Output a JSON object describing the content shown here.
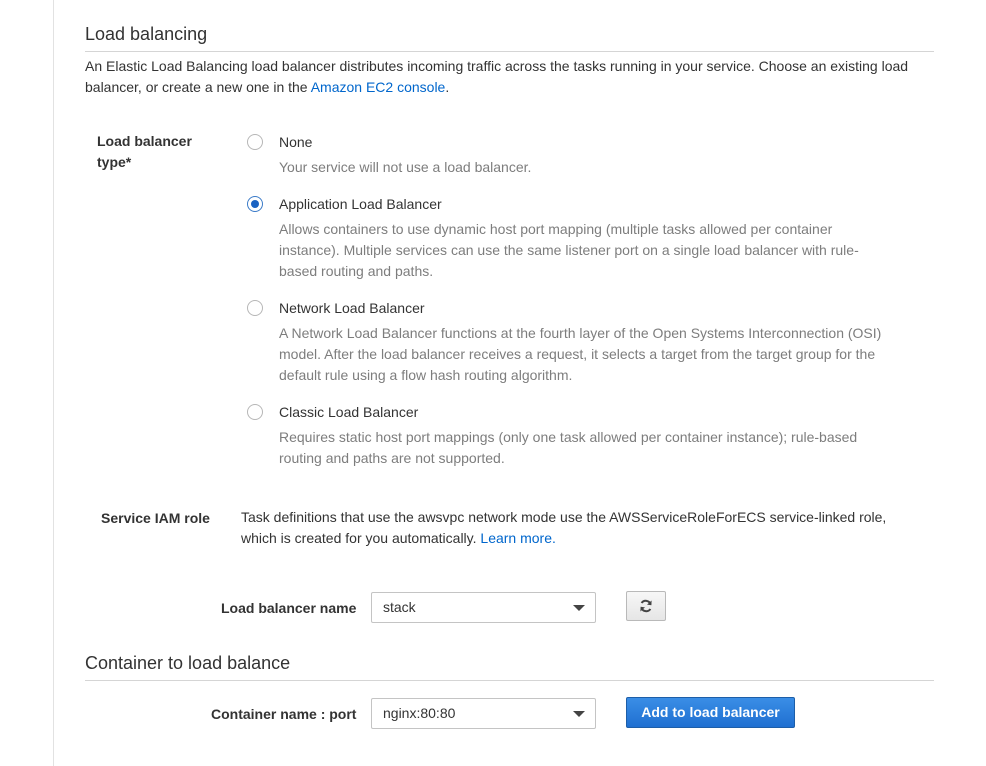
{
  "load_balancing": {
    "title": "Load balancing",
    "description_before_link": "An Elastic Load Balancing load balancer distributes incoming traffic across the tasks running in your service. Choose an existing load balancer, or create a new one in the ",
    "description_link": "Amazon EC2 console",
    "description_after_link": ".",
    "type_label": "Load balancer type*",
    "options": [
      {
        "label": "None",
        "description": "Your service will not use a load balancer.",
        "selected": false
      },
      {
        "label": "Application Load Balancer",
        "description": "Allows containers to use dynamic host port mapping (multiple tasks allowed per container instance). Multiple services can use the same listener port on a single load balancer with rule-based routing and paths.",
        "selected": true
      },
      {
        "label": "Network Load Balancer",
        "description": "A Network Load Balancer functions at the fourth layer of the Open Systems Interconnection (OSI) model. After the load balancer receives a request, it selects a target from the target group for the default rule using a flow hash routing algorithm.",
        "selected": false
      },
      {
        "label": "Classic Load Balancer",
        "description": "Requires static host port mappings (only one task allowed per container instance); rule-based routing and paths are not supported.",
        "selected": false
      }
    ],
    "iam_label": "Service IAM role",
    "iam_text": "Task definitions that use the awsvpc network mode use the AWSServiceRoleForECS service-linked role, which is created for you automatically. ",
    "iam_link": "Learn more.",
    "lb_name_label": "Load balancer name",
    "lb_name_value": "stack"
  },
  "container_section": {
    "title": "Container to load balance",
    "container_label": "Container name : port",
    "container_value": "nginx:80:80",
    "add_button": "Add to load balancer"
  },
  "colors": {
    "accent": "#1f6fd1",
    "link": "#0066cc",
    "muted_text": "#7d7d7d"
  },
  "icons": {
    "refresh": "refresh-icon",
    "dropdown": "chevron-down-icon"
  }
}
